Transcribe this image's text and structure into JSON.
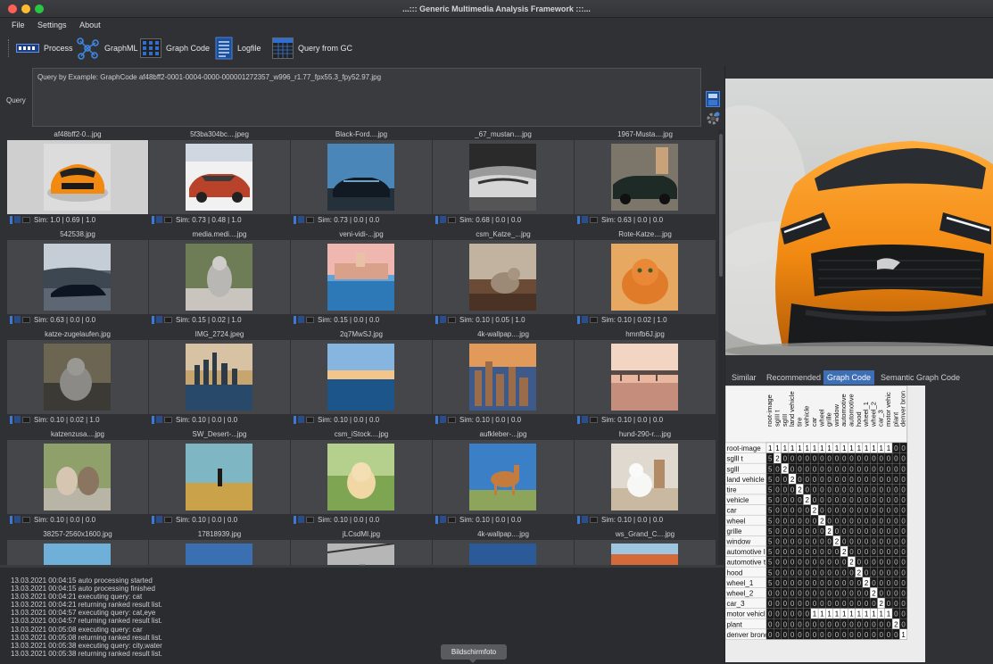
{
  "window": {
    "title": "...::: Generic Multimedia Analysis Framework :::..."
  },
  "menu": [
    "File",
    "Settings",
    "About"
  ],
  "toolbar": {
    "process": "Process",
    "graphml": "GraphML",
    "graph_code": "Graph Code",
    "logfile": "Logfile",
    "query_gc": "Query from GC"
  },
  "query": {
    "label": "Query",
    "text": "Query by Example: GraphCode af48bff2-0001-0004-0000-000001272357_w996_r1.77_fpx55.3_fpy52.97.jpg"
  },
  "results": [
    {
      "name": "af48bff2-0...jpg",
      "sim": "Sim: 1.0 | 0.69 | 1.0",
      "selected": true,
      "img": "mustang-orange"
    },
    {
      "name": "5f3ba304bc....jpeg",
      "sim": "Sim: 0.73 | 0.48 | 1.0",
      "img": "classic-red"
    },
    {
      "name": "Black-Ford....jpg",
      "sim": "Sim: 0.73 | 0.0 | 0.0",
      "img": "black-mustang"
    },
    {
      "name": "_67_mustan....jpg",
      "sim": "Sim: 0.68 | 0.0 | 0.0",
      "img": "bw-mustang"
    },
    {
      "name": "1967-Musta....jpg",
      "sim": "Sim: 0.63 | 0.0 | 0.0",
      "img": "woman-car"
    },
    {
      "name": "542538.jpg",
      "sim": "Sim: 0.63 | 0.0 | 0.0",
      "img": "dark-car"
    },
    {
      "name": "media.medi....jpg",
      "sim": "Sim: 0.15 | 0.02 | 1.0",
      "img": "cat-walk"
    },
    {
      "name": "veni-vidi-...jpg",
      "sim": "Sim: 0.15 | 0.0 | 0.0",
      "img": "venice"
    },
    {
      "name": "csm_Katze_...jpg",
      "sim": "Sim: 0.10 | 0.05 | 1.0",
      "img": "cat-window"
    },
    {
      "name": "Rote-Katze....jpg",
      "sim": "Sim: 0.10 | 0.02 | 1.0",
      "img": "orange-cat"
    },
    {
      "name": "katze-zugelaufen.jpg",
      "sim": "Sim: 0.10 | 0.02 | 1.0",
      "img": "grey-cat"
    },
    {
      "name": "IMG_2724.jpeg",
      "sim": "Sim: 0.10 | 0.0 | 0.0",
      "img": "chicago"
    },
    {
      "name": "2q7MwSJ.jpg",
      "sim": "Sim: 0.10 | 0.0 | 0.0",
      "img": "lake-sunset"
    },
    {
      "name": "4k-wallpap....jpg",
      "sim": "Sim: 0.10 | 0.0 | 0.0",
      "img": "city-dusk"
    },
    {
      "name": "hmnfb6J.jpg",
      "sim": "Sim: 0.10 | 0.0 | 0.0",
      "img": "pier"
    },
    {
      "name": "katzenzusa....jpg",
      "sim": "Sim: 0.10 | 0.0 | 0.0",
      "img": "two-cats"
    },
    {
      "name": "SW_Desert-...jpg",
      "sim": "Sim: 0.10 | 0.0 | 0.0",
      "img": "desert"
    },
    {
      "name": "csm_iStock....jpg",
      "sim": "Sim: 0.10 | 0.0 | 0.0",
      "img": "puppy"
    },
    {
      "name": "aufkleber-...jpg",
      "sim": "Sim: 0.10 | 0.0 | 0.0",
      "img": "horse"
    },
    {
      "name": "hund-290-r....jpg",
      "sim": "Sim: 0.10 | 0.0 | 0.0",
      "img": "white-dog"
    },
    {
      "name": "38257-2560x1600.jpg",
      "sim": "",
      "img": "sky"
    },
    {
      "name": "17818939.jpg",
      "sim": "",
      "img": "skyline"
    },
    {
      "name": "jLCsdMI.jpg",
      "sim": "",
      "img": "bridge"
    },
    {
      "name": "4k-wallpap....jpg",
      "sim": "",
      "img": "blue"
    },
    {
      "name": "ws_Grand_C....jpg",
      "sim": "",
      "img": "canyon"
    }
  ],
  "log": [
    "13.03.2021 00:04:15   auto processing started",
    "13.03.2021 00:04:15   auto processing finished",
    "13.03.2021 00:04:21   executing query: cat",
    "13.03.2021 00:04:21   returning ranked result list.",
    "13.03.2021 00:04:57   executing query: cat,eye",
    "13.03.2021 00:04:57   returning ranked result list.",
    "13.03.2021 00:05:08   executing query: car",
    "13.03.2021 00:05:08   returning ranked result list.",
    "13.03.2021 00:05:38   executing query: city,water",
    "13.03.2021 00:05:38   returning ranked result list."
  ],
  "tabs": [
    "Similar",
    "Recommended",
    "Graph Code",
    "Semantic Graph Code"
  ],
  "active_tab": "Graph Code",
  "graph_code": {
    "col_labels": [
      "root-image",
      "sgIII t",
      "sgIII",
      "land vehicle",
      "tire",
      "vehicle",
      "car",
      "wheel",
      "grille",
      "window",
      "automotive",
      "automotive",
      "hood",
      "wheel_1",
      "wheel_2",
      "car_3",
      "motor vehic",
      "plant",
      "denver bron"
    ],
    "row_labels": [
      "root-image",
      "sglll t",
      "sglll",
      "land vehicle",
      "tire",
      "vehicle",
      "car",
      "wheel",
      "grille",
      "window",
      "automotive l",
      "automotive t",
      "hood",
      "wheel_1",
      "wheel_2",
      "car_3",
      "motor vehicl",
      "plant",
      "denver bronc"
    ],
    "rows": [
      "1111111111111111100",
      "5200000000000000000",
      "5020000000000000000",
      "5002000000000000000",
      "5000200000000000000",
      "5000020000000000000",
      "5000002000000000000",
      "5000000200000000000",
      "5000000020000000000",
      "5000000002000000000",
      "5000000000200000000",
      "5000000000020000000",
      "5000000000002000000",
      "5000000000000200000",
      "0000000000000020000",
      "0000000000000002000",
      "0000001111111111100",
      "0000000000000000020",
      "0000000000000000001"
    ]
  },
  "tooltip": "Bildschirmfoto",
  "colors": {
    "accent": "#3d6fb6",
    "cell_dark": "#1a1a1a",
    "cell_light": "#ffffff"
  }
}
